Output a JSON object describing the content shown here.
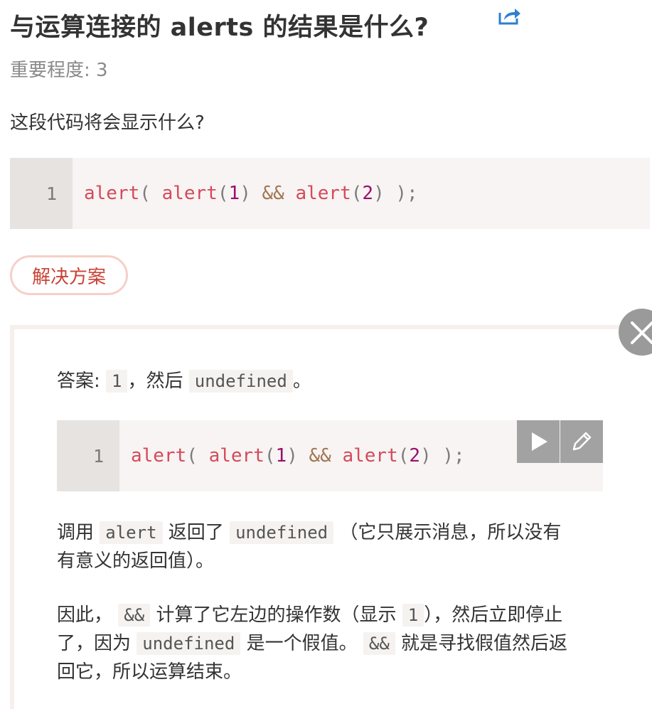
{
  "header": {
    "title": "与运算连接的 alerts 的结果是什么?",
    "importance": "重要程度: 3"
  },
  "question": "这段代码将会显示什么?",
  "code_task": {
    "line_number": "1",
    "tokens": [
      "alert",
      "( ",
      "alert",
      "(",
      "1",
      ")",
      " && ",
      "alert",
      "(",
      "2",
      ")",
      " );"
    ]
  },
  "solution_button": {
    "label": "解决方案"
  },
  "solution": {
    "answer": {
      "prefix": "答案:",
      "code1": "1",
      "middle": "，然后",
      "code2": "undefined",
      "suffix": "。"
    },
    "code_example": {
      "line_number": "1",
      "tokens": [
        "alert",
        "( ",
        "alert",
        "(",
        "1",
        ")",
        " && ",
        "alert",
        "(",
        "2",
        ")",
        " );"
      ]
    },
    "para1": {
      "prefix": "调用",
      "code1": "alert",
      "middle": "返回了",
      "code2": "undefined",
      "line1_rest": "（它只展示消息，所以没有",
      "line2": "有意义的返回值）。"
    },
    "para2": {
      "prefix": "因此，",
      "code1": "&&",
      "middle1": "计算了它左边的操作数（显示",
      "code2": "1",
      "line1_rest": "），然后立即停止",
      "line2_prefix": "了，因为",
      "code3": "undefined",
      "line2_middle": "是一个假值。",
      "code4": "&&",
      "line2_rest": "就是寻找假值然后返",
      "line3": "回它，所以运算结束。"
    }
  },
  "icons": {
    "share": "share-icon",
    "close": "close-icon",
    "run": "play-icon",
    "edit": "pencil-icon"
  },
  "colors": {
    "function": "#d44a5a",
    "number": "#9a0e6a",
    "operator": "#a2754f",
    "solution_border": "#f5d0c8",
    "solution_text": "#c94236",
    "share_icon": "#2e7fcf"
  }
}
